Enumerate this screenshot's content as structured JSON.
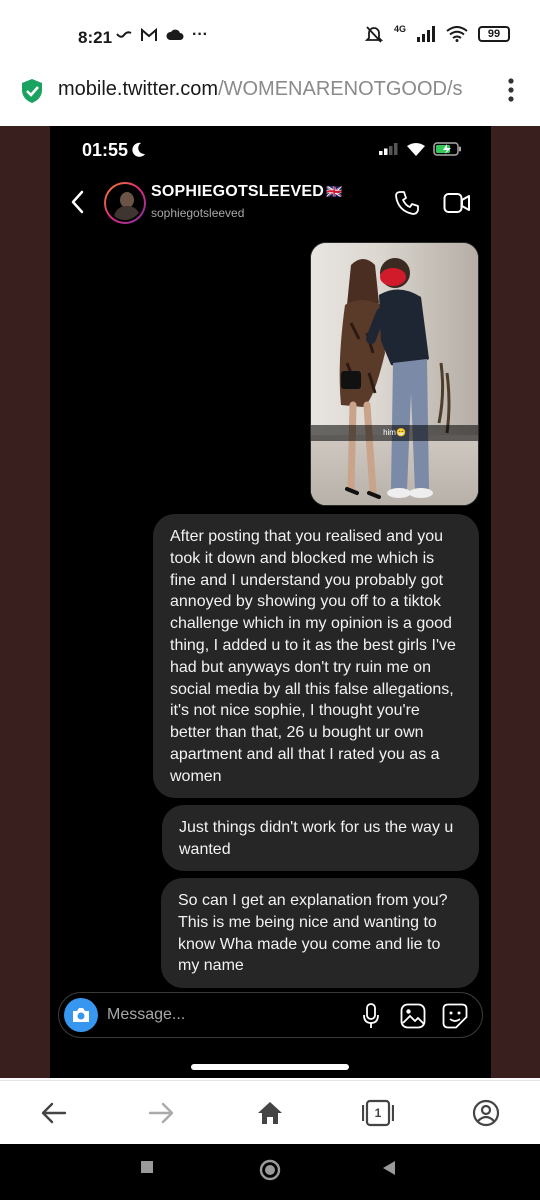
{
  "android_status": {
    "time": "8:21",
    "network": "4G",
    "battery": "99",
    "more": "···"
  },
  "browser": {
    "url_host": "mobile.twitter.com",
    "url_path": "/WOMENARENOTGOOD/s"
  },
  "phone_status": {
    "time": "01:55"
  },
  "chat_header": {
    "name": "SOPHIEGOTSLEEVED",
    "flag": "🇬🇧",
    "handle": "sophiegotsleeved"
  },
  "photo": {
    "caption": "him😁"
  },
  "messages": [
    {
      "text": "After posting that you realised and you took it down and blocked me which is fine and I understand you probably got annoyed by showing you off to a tiktok challenge which in my opinion is a good thing, I added u to it as the best girls I've had but anyways don't try ruin me on social media by all this false allegations, it's not nice sophie, I thought you're better than that, 26 u bought ur own apartment and all that I rated you as a women"
    },
    {
      "text": "Just things didn't work for us the way u wanted"
    },
    {
      "text": "So can I get an explanation from you? This is me being nice and wanting to know Wha made you come and lie to my name"
    }
  ],
  "composer": {
    "placeholder": "Message..."
  },
  "browser_nav": {
    "tab_count": "1"
  },
  "colors": {
    "page_background": "#3a1f1f",
    "bubble": "#262626",
    "camera_button": "#3797f0",
    "secure_shield": "#1aa260"
  }
}
